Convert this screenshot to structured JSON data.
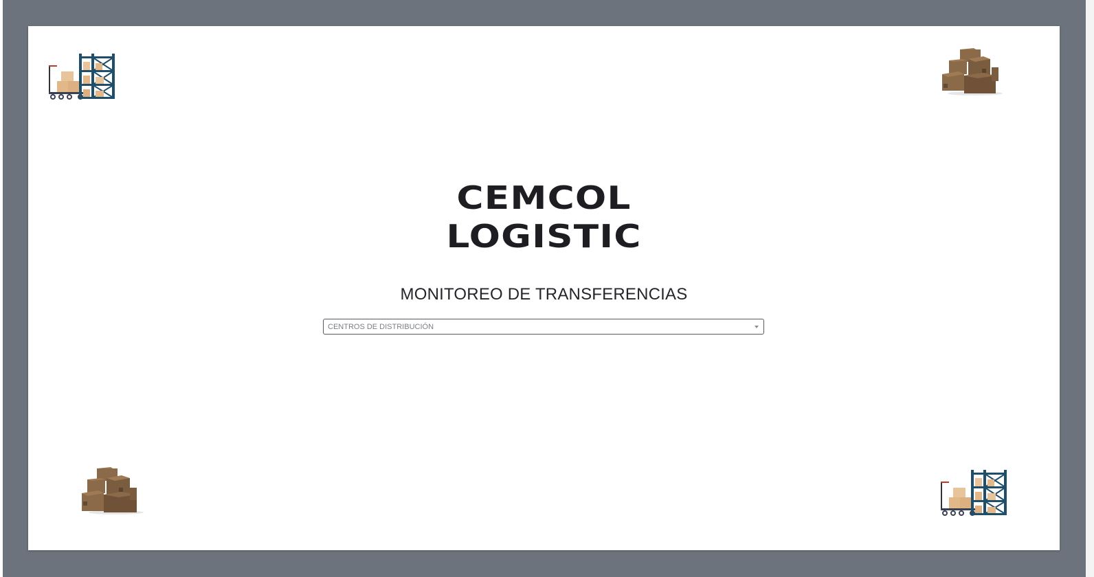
{
  "brand": {
    "line1": "CEMCOL",
    "line2": "LOGISTIC"
  },
  "page": {
    "subtitle": "MONITOREO DE TRANSFERENCIAS"
  },
  "selector": {
    "selected_value": "CENTROS DE DISTRIBUCIÓN"
  },
  "decorations": {
    "top_left": "warehouse-shelf-cart-icon",
    "top_right": "stacked-boxes-icon",
    "bottom_left": "stacked-boxes-icon",
    "bottom_right": "warehouse-shelf-cart-icon"
  },
  "colors": {
    "backdrop": "#6c737c",
    "card": "#ffffff",
    "text": "#1e1e22",
    "box_brown": "#8b6a4a",
    "shelf_blue": "#1f4e6b"
  }
}
